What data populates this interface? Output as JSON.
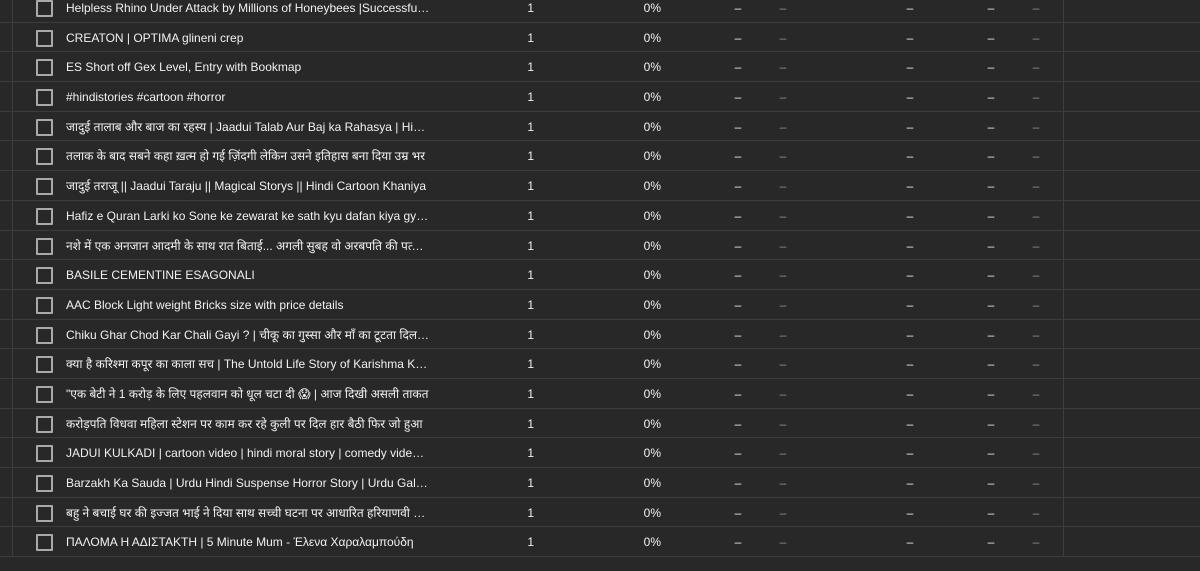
{
  "dash_glyph": "–",
  "rows": [
    {
      "title": "Helpless Rhino Under Attack by Millions of Honeybees |Successful Rescue Mission",
      "count": "1",
      "percent": "0%"
    },
    {
      "title": "CREATON | OPTIMA glineni crep",
      "count": "1",
      "percent": "0%"
    },
    {
      "title": "ES Short off Gex Level, Entry with Bookmap",
      "count": "1",
      "percent": "0%"
    },
    {
      "title": "#hindistories #cartoon #horror",
      "count": "1",
      "percent": "0%"
    },
    {
      "title": "जादुई तालाब और बाज का रहस्य | Jaadui Talab Aur Baj ka Rahasya | Hindi Kahaniya",
      "count": "1",
      "percent": "0%"
    },
    {
      "title": "तलाक के बाद सबने कहा ख़त्म हो गई ज़िंदगी लेकिन उसने इतिहास बना दिया उम्र भर",
      "count": "1",
      "percent": "0%"
    },
    {
      "title": "जादुई तराजू || Jaadui Taraju || Magical Storys || Hindi Cartoon Khaniya",
      "count": "1",
      "percent": "0%"
    },
    {
      "title": "Hafiz e Quran Larki ko Sone ke zewarat ke sath kyu dafan kiya gya? sachi kahani",
      "count": "1",
      "percent": "0%"
    },
    {
      "title": "नशे में एक अनजान आदमी के साथ रात बिताई... अगली सुबह वो अरबपति की पत्नी बनी",
      "count": "1",
      "percent": "0%"
    },
    {
      "title": "BASILE CEMENTINE ESAGONALI",
      "count": "1",
      "percent": "0%"
    },
    {
      "title": "AAC Block Light weight Bricks size with price details",
      "count": "1",
      "percent": "0%"
    },
    {
      "title": "Chiku Ghar Chod Kar Chali Gayi ? | चीकू का गुस्सा और माँ का टूटता दिल | कहानी",
      "count": "1",
      "percent": "0%"
    },
    {
      "title": "क्या है करिश्मा कपूर का काला सच | The Untold Life Story of Karishma Kapoor",
      "count": "1",
      "percent": "0%"
    },
    {
      "title": "\"एक बेटी ने 1 करोड़ के लिए पहलवान को धूल चटा दी 😱 | आज दिखी असली ताकत",
      "count": "1",
      "percent": "0%"
    },
    {
      "title": "करोड़पति विधवा महिला स्टेशन पर काम कर रहे कुली पर दिल हार बैठी फिर जो हुआ",
      "count": "1",
      "percent": "0%"
    },
    {
      "title": "JADUI KULKADI | cartoon video | hindi moral story | comedy video |funny video",
      "count": "1",
      "percent": "0%"
    },
    {
      "title": "Barzakh Ka Sauda | Urdu Hindi Suspense Horror Story | Urdu Galaxy",
      "count": "1",
      "percent": "0%"
    },
    {
      "title": "बहु ने बचाई घर की इज्जत भाई ने दिया साथ सच्ची घटना पर आधारित हरियाणवी कहानी",
      "count": "1",
      "percent": "0%"
    },
    {
      "title": "ΠΑΛΟΜΑ Η ΑΔΙΣΤΑΚΤΗ | 5 Minute Mum - Έλενα Χαραλαμπούδη",
      "count": "1",
      "percent": "0%"
    }
  ]
}
